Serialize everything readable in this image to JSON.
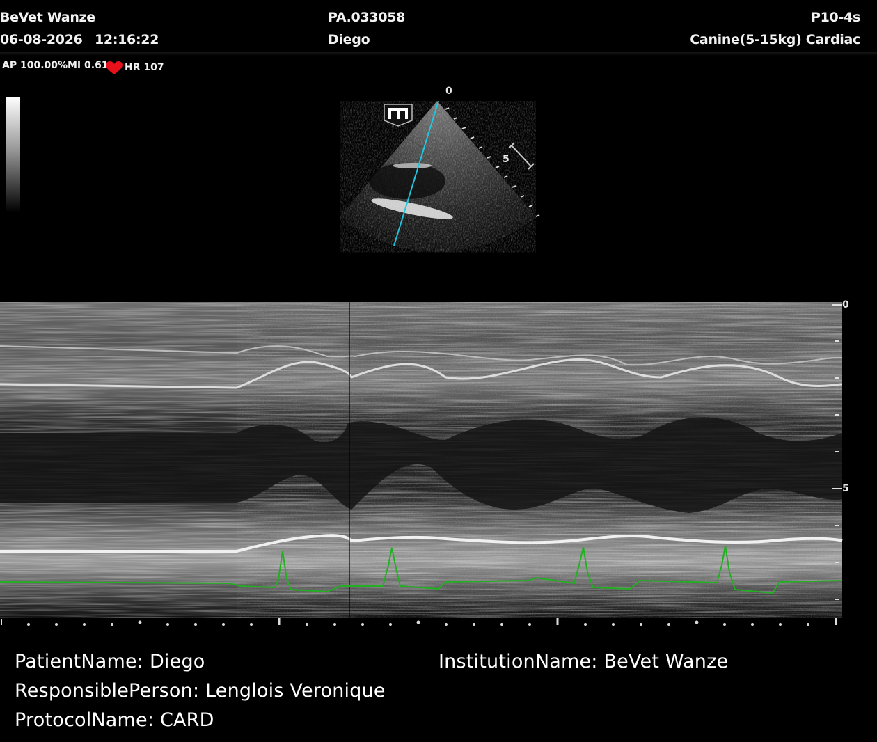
{
  "header": {
    "institution": "BeVet Wanze",
    "date": "06-08-2026",
    "time": "12:16:22",
    "patient_id": "PA.033058",
    "patient_name": "Diego",
    "probe": "P10-4s",
    "preset": "Canine(5-15kg) Cardiac"
  },
  "status": {
    "ap": "AP 100.00%",
    "mi": "MI 0.61",
    "hr": "HR 107",
    "heart_icon": "heart-icon",
    "heart_color": "#e8101a"
  },
  "sector": {
    "mode_icon": "m-mode-icon",
    "depth_top": "0",
    "depth_mid": "5",
    "cursor_color": "#1ec8e0"
  },
  "mmode": {
    "depth_top": "0",
    "depth_mid": "5",
    "ecg_color": "#22b022"
  },
  "footer": {
    "patient_name": "PatientName: Diego",
    "responsible_person": "ResponsiblePerson: Lenglois Veronique",
    "protocol_name": "ProtocolName: CARD",
    "institution_name": "InstitutionName: BeVet Wanze"
  }
}
